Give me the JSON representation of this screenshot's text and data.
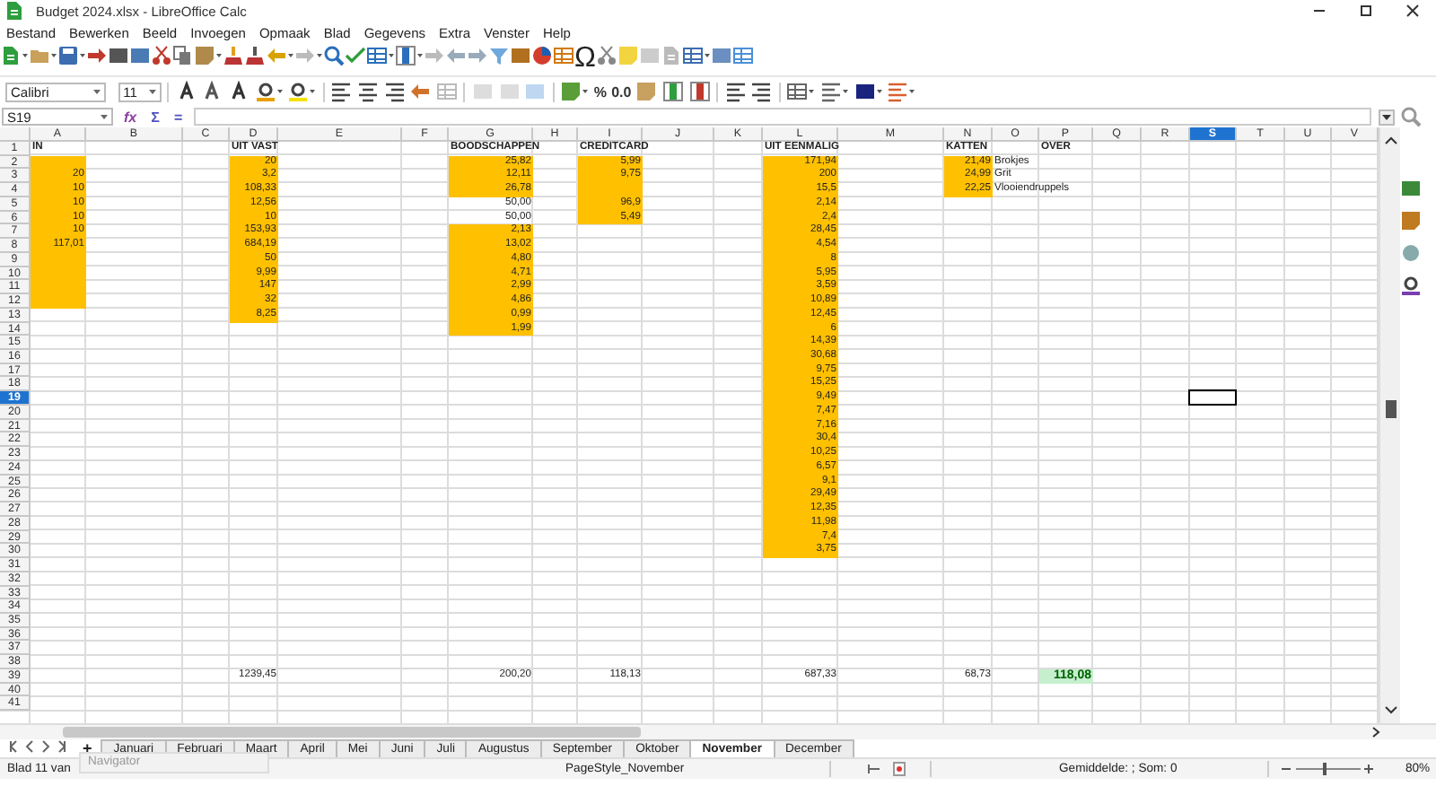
{
  "window": {
    "title": "Budget 2024.xlsx - LibreOffice Calc"
  },
  "menu": [
    "Bestand",
    "Bewerken",
    "Beeld",
    "Invoegen",
    "Opmaak",
    "Blad",
    "Gegevens",
    "Extra",
    "Venster",
    "Help"
  ],
  "standard_toolbar": {
    "special_character": "Ω"
  },
  "formatting_toolbar": {
    "font_name": "Calibri",
    "font_size": "11",
    "percent": "%",
    "decimals": "0.0"
  },
  "formula_bar": {
    "name_box": "S19",
    "buttons": [
      "fx",
      "Σ",
      "="
    ]
  },
  "columns": [
    {
      "label": "A",
      "selected": false
    },
    {
      "label": "B",
      "selected": false
    },
    {
      "label": "C",
      "selected": false
    },
    {
      "label": "D",
      "selected": false
    },
    {
      "label": "E",
      "selected": false
    },
    {
      "label": "F",
      "selected": false
    },
    {
      "label": "G",
      "selected": false
    },
    {
      "label": "H",
      "selected": false
    },
    {
      "label": "I",
      "selected": false
    },
    {
      "label": "J",
      "selected": false
    },
    {
      "label": "K",
      "selected": false
    },
    {
      "label": "L",
      "selected": false
    },
    {
      "label": "M",
      "selected": false
    },
    {
      "label": "N",
      "selected": false
    },
    {
      "label": "O",
      "selected": false
    },
    {
      "label": "P",
      "selected": false
    },
    {
      "label": "Q",
      "selected": false
    },
    {
      "label": "R",
      "selected": false
    },
    {
      "label": "S",
      "selected": true
    },
    {
      "label": "T",
      "selected": false
    },
    {
      "label": "U",
      "selected": false
    },
    {
      "label": "V",
      "selected": false
    }
  ],
  "rows": [
    {
      "header": "1",
      "selected": false,
      "cells": [
        {
          "text": "IN",
          "kind": "label",
          "highlighted": false
        },
        null,
        null,
        {
          "text": "UIT VAST",
          "kind": "label",
          "highlighted": false
        },
        null,
        null,
        {
          "text": "BOODSCHAPPEN",
          "kind": "label",
          "highlighted": false
        },
        null,
        {
          "text": "CREDITCARD",
          "kind": "label",
          "highlighted": false
        },
        null,
        null,
        {
          "text": "UIT EENMALIG",
          "kind": "label",
          "highlighted": false
        },
        null,
        {
          "text": "KATTEN",
          "kind": "label",
          "highlighted": false
        },
        null,
        {
          "text": "OVER",
          "kind": "label",
          "highlighted": false
        }
      ]
    },
    {
      "header": "2",
      "selected": false,
      "cells": [
        {
          "highlighted": true
        },
        null,
        null,
        {
          "text": "20",
          "kind": "number",
          "highlighted": true
        },
        null,
        null,
        {
          "text": "25,82",
          "kind": "number",
          "highlighted": true
        },
        null,
        {
          "text": "5,99",
          "kind": "number",
          "highlighted": true
        },
        null,
        null,
        {
          "text": "171,94",
          "kind": "number",
          "highlighted": true
        },
        null,
        {
          "text": "21,49",
          "kind": "number",
          "highlighted": true
        },
        {
          "text": "Brokjes",
          "kind": "text",
          "highlighted": false
        }
      ]
    },
    {
      "header": "3",
      "selected": false,
      "cells": [
        {
          "text": "20",
          "kind": "number",
          "highlighted": true
        },
        null,
        null,
        {
          "text": "3,2",
          "kind": "number",
          "highlighted": true
        },
        null,
        null,
        {
          "text": "12,11",
          "kind": "number",
          "highlighted": true
        },
        null,
        {
          "text": "9,75",
          "kind": "number",
          "highlighted": true
        },
        null,
        null,
        {
          "text": "200",
          "kind": "number",
          "highlighted": true
        },
        null,
        {
          "text": "24,99",
          "kind": "number",
          "highlighted": true
        },
        {
          "text": "Grit",
          "kind": "text",
          "highlighted": false
        }
      ]
    },
    {
      "header": "4",
      "selected": false,
      "cells": [
        {
          "text": "10",
          "kind": "number",
          "highlighted": true
        },
        null,
        null,
        {
          "text": "108,33",
          "kind": "number",
          "highlighted": true
        },
        null,
        null,
        {
          "text": "26,78",
          "kind": "number",
          "highlighted": true
        },
        null,
        {
          "highlighted": true
        },
        null,
        null,
        {
          "text": "15,5",
          "kind": "number",
          "highlighted": true
        },
        null,
        {
          "text": "22,25",
          "kind": "number",
          "highlighted": true
        },
        {
          "text": "Vlooiendruppels",
          "kind": "text",
          "highlighted": false
        }
      ]
    },
    {
      "header": "5",
      "selected": false,
      "cells": [
        {
          "text": "10",
          "kind": "number",
          "highlighted": true
        },
        null,
        null,
        {
          "text": "12,56",
          "kind": "number",
          "highlighted": true
        },
        null,
        null,
        {
          "text": "50,00",
          "kind": "number",
          "highlighted": false
        },
        null,
        {
          "text": "96,9",
          "kind": "number",
          "highlighted": true
        },
        null,
        null,
        {
          "text": "2,14",
          "kind": "number",
          "highlighted": true
        }
      ]
    },
    {
      "header": "6",
      "selected": false,
      "cells": [
        {
          "text": "10",
          "kind": "number",
          "highlighted": true
        },
        null,
        null,
        {
          "text": "10",
          "kind": "number",
          "highlighted": true
        },
        null,
        null,
        {
          "text": "50,00",
          "kind": "number",
          "highlighted": false
        },
        null,
        {
          "text": "5,49",
          "kind": "number",
          "highlighted": true
        },
        null,
        null,
        {
          "text": "2,4",
          "kind": "number",
          "highlighted": true
        }
      ]
    },
    {
      "header": "7",
      "selected": false,
      "cells": [
        {
          "text": "10",
          "kind": "number",
          "highlighted": true
        },
        null,
        null,
        {
          "text": "153,93",
          "kind": "number",
          "highlighted": true
        },
        null,
        null,
        {
          "text": "2,13",
          "kind": "number",
          "highlighted": true
        },
        null,
        null,
        null,
        null,
        {
          "text": "28,45",
          "kind": "number",
          "highlighted": true
        }
      ]
    },
    {
      "header": "8",
      "selected": false,
      "cells": [
        {
          "text": "117,01",
          "kind": "number",
          "highlighted": true
        },
        null,
        null,
        {
          "text": "684,19",
          "kind": "number",
          "highlighted": true
        },
        null,
        null,
        {
          "text": "13,02",
          "kind": "number",
          "highlighted": true
        },
        null,
        null,
        null,
        null,
        {
          "text": "4,54",
          "kind": "number",
          "highlighted": true
        }
      ]
    },
    {
      "header": "9",
      "selected": false,
      "cells": [
        {
          "highlighted": true
        },
        null,
        null,
        {
          "text": "50",
          "kind": "number",
          "highlighted": true
        },
        null,
        null,
        {
          "text": "4,80",
          "kind": "number",
          "highlighted": true
        },
        null,
        null,
        null,
        null,
        {
          "text": "8",
          "kind": "number",
          "highlighted": true
        }
      ]
    },
    {
      "header": "10",
      "selected": false,
      "cells": [
        {
          "highlighted": true
        },
        null,
        null,
        {
          "text": "9,99",
          "kind": "number",
          "highlighted": true
        },
        null,
        null,
        {
          "text": "4,71",
          "kind": "number",
          "highlighted": true
        },
        null,
        null,
        null,
        null,
        {
          "text": "5,95",
          "kind": "number",
          "highlighted": true
        }
      ]
    },
    {
      "header": "11",
      "selected": false,
      "cells": [
        {
          "highlighted": true
        },
        null,
        null,
        {
          "text": "147",
          "kind": "number",
          "highlighted": true
        },
        null,
        null,
        {
          "text": "2,99",
          "kind": "number",
          "highlighted": true
        },
        null,
        null,
        null,
        null,
        {
          "text": "3,59",
          "kind": "number",
          "highlighted": true
        }
      ]
    },
    {
      "header": "12",
      "selected": false,
      "cells": [
        {
          "highlighted": true
        },
        null,
        null,
        {
          "text": "32",
          "kind": "number",
          "highlighted": true
        },
        null,
        null,
        {
          "text": "4,86",
          "kind": "number",
          "highlighted": true
        },
        null,
        null,
        null,
        null,
        {
          "text": "10,89",
          "kind": "number",
          "highlighted": true
        }
      ]
    },
    {
      "header": "13",
      "selected": false,
      "cells": [
        null,
        null,
        null,
        {
          "text": "8,25",
          "kind": "number",
          "highlighted": true
        },
        null,
        null,
        {
          "text": "0,99",
          "kind": "number",
          "highlighted": true
        },
        null,
        null,
        null,
        null,
        {
          "text": "12,45",
          "kind": "number",
          "highlighted": true
        }
      ]
    },
    {
      "header": "14",
      "selected": false,
      "cells": [
        null,
        null,
        null,
        null,
        null,
        null,
        {
          "text": "1,99",
          "kind": "number",
          "highlighted": true
        },
        null,
        null,
        null,
        null,
        {
          "text": "6",
          "kind": "number",
          "highlighted": true
        }
      ]
    },
    {
      "header": "15",
      "selected": false,
      "cells": [
        null,
        null,
        null,
        null,
        null,
        null,
        null,
        null,
        null,
        null,
        null,
        {
          "text": "14,39",
          "kind": "number",
          "highlighted": true
        }
      ]
    },
    {
      "header": "16",
      "selected": false,
      "cells": [
        null,
        null,
        null,
        null,
        null,
        null,
        null,
        null,
        null,
        null,
        null,
        {
          "text": "30,68",
          "kind": "number",
          "highlighted": true
        }
      ]
    },
    {
      "header": "17",
      "selected": false,
      "cells": [
        null,
        null,
        null,
        null,
        null,
        null,
        null,
        null,
        null,
        null,
        null,
        {
          "text": "9,75",
          "kind": "number",
          "highlighted": true
        }
      ]
    },
    {
      "header": "18",
      "selected": false,
      "cells": [
        null,
        null,
        null,
        null,
        null,
        null,
        null,
        null,
        null,
        null,
        null,
        {
          "text": "15,25",
          "kind": "number",
          "highlighted": true
        }
      ]
    },
    {
      "header": "19",
      "selected": true,
      "cells": [
        null,
        null,
        null,
        null,
        null,
        null,
        null,
        null,
        null,
        null,
        null,
        {
          "text": "9,49",
          "kind": "number",
          "highlighted": true
        }
      ]
    },
    {
      "header": "20",
      "selected": false,
      "cells": [
        null,
        null,
        null,
        null,
        null,
        null,
        null,
        null,
        null,
        null,
        null,
        {
          "text": "7,47",
          "kind": "number",
          "highlighted": true
        }
      ]
    },
    {
      "header": "21",
      "selected": false,
      "cells": [
        null,
        null,
        null,
        null,
        null,
        null,
        null,
        null,
        null,
        null,
        null,
        {
          "text": "7,16",
          "kind": "number",
          "highlighted": true
        }
      ]
    },
    {
      "header": "22",
      "selected": false,
      "cells": [
        null,
        null,
        null,
        null,
        null,
        null,
        null,
        null,
        null,
        null,
        null,
        {
          "text": "30,4",
          "kind": "number",
          "highlighted": true
        }
      ]
    },
    {
      "header": "23",
      "selected": false,
      "cells": [
        null,
        null,
        null,
        null,
        null,
        null,
        null,
        null,
        null,
        null,
        null,
        {
          "text": "10,25",
          "kind": "number",
          "highlighted": true
        }
      ]
    },
    {
      "header": "24",
      "selected": false,
      "cells": [
        null,
        null,
        null,
        null,
        null,
        null,
        null,
        null,
        null,
        null,
        null,
        {
          "text": "6,57",
          "kind": "number",
          "highlighted": true
        }
      ]
    },
    {
      "header": "25",
      "selected": false,
      "cells": [
        null,
        null,
        null,
        null,
        null,
        null,
        null,
        null,
        null,
        null,
        null,
        {
          "text": "9,1",
          "kind": "number",
          "highlighted": true
        }
      ]
    },
    {
      "header": "26",
      "selected": false,
      "cells": [
        null,
        null,
        null,
        null,
        null,
        null,
        null,
        null,
        null,
        null,
        null,
        {
          "text": "29,49",
          "kind": "number",
          "highlighted": true
        }
      ]
    },
    {
      "header": "27",
      "selected": false,
      "cells": [
        null,
        null,
        null,
        null,
        null,
        null,
        null,
        null,
        null,
        null,
        null,
        {
          "text": "12,35",
          "kind": "number",
          "highlighted": true
        }
      ]
    },
    {
      "header": "28",
      "selected": false,
      "cells": [
        null,
        null,
        null,
        null,
        null,
        null,
        null,
        null,
        null,
        null,
        null,
        {
          "text": "11,98",
          "kind": "number",
          "highlighted": true
        }
      ]
    },
    {
      "header": "29",
      "selected": false,
      "cells": [
        null,
        null,
        null,
        null,
        null,
        null,
        null,
        null,
        null,
        null,
        null,
        {
          "text": "7,4",
          "kind": "number",
          "highlighted": true
        }
      ]
    },
    {
      "header": "30",
      "selected": false,
      "cells": [
        null,
        null,
        null,
        null,
        null,
        null,
        null,
        null,
        null,
        null,
        null,
        {
          "text": "3,75",
          "kind": "number",
          "highlighted": true
        }
      ]
    },
    {
      "header": "31",
      "selected": false
    },
    {
      "header": "32",
      "selected": false
    },
    {
      "header": "33",
      "selected": false
    },
    {
      "header": "34",
      "selected": false
    },
    {
      "header": "35",
      "selected": false
    },
    {
      "header": "36",
      "selected": false
    },
    {
      "header": "37",
      "selected": false
    },
    {
      "header": "38",
      "selected": false
    },
    {
      "header": "39",
      "selected": false,
      "cells": [
        null,
        null,
        null,
        {
          "text": "1239,45",
          "kind": "number",
          "highlighted": false
        },
        null,
        null,
        {
          "text": "200,20",
          "kind": "number",
          "highlighted": false
        },
        null,
        {
          "text": "118,13",
          "kind": "number",
          "highlighted": false
        },
        null,
        null,
        {
          "text": "687,33",
          "kind": "number",
          "highlighted": false
        },
        null,
        {
          "text": "68,73",
          "kind": "number",
          "highlighted": false
        },
        null,
        {
          "text": "118,08",
          "kind": "total",
          "highlighted": false
        }
      ]
    },
    {
      "header": "40",
      "selected": false
    },
    {
      "header": "41",
      "selected": false
    }
  ],
  "add_sheet": "+",
  "sheet_tabs": [
    {
      "label": "Januari",
      "selected": false
    },
    {
      "label": "Februari",
      "selected": false
    },
    {
      "label": "Maart",
      "selected": false
    },
    {
      "label": "April",
      "selected": false
    },
    {
      "label": "Mei",
      "selected": false
    },
    {
      "label": "Juni",
      "selected": false
    },
    {
      "label": "Juli",
      "selected": false
    },
    {
      "label": "Augustus",
      "selected": false
    },
    {
      "label": "September",
      "selected": false
    },
    {
      "label": "Oktober",
      "selected": false
    },
    {
      "label": "November",
      "selected": true
    },
    {
      "label": "December",
      "selected": false
    }
  ],
  "tooltip": "Navigator",
  "status_bar": {
    "sheet": "Blad 11 van",
    "page_style": "PageStyle_November",
    "summary": "Gemiddelde: ; Som: 0",
    "zoom": "80%",
    "zoom_slider": {
      "level": 0.44
    }
  }
}
